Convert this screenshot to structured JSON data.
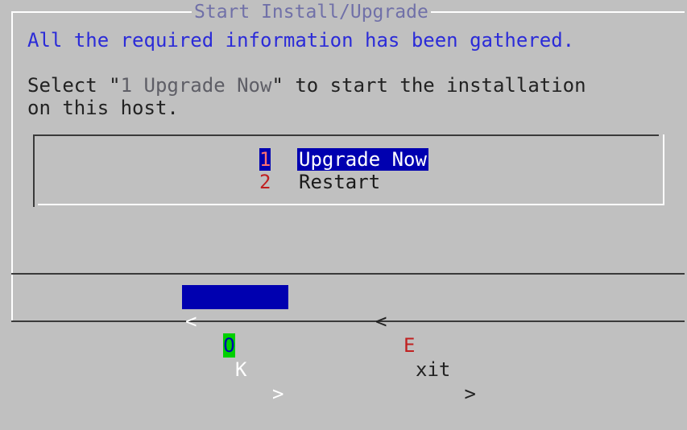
{
  "dialog": {
    "title": "Start Install/Upgrade",
    "line1": "All the required information has been gathered.",
    "line2_prefix": "Select \"",
    "line2_highlight": "1 Upgrade Now",
    "line2_suffix": "\" to start the installation",
    "line3": "on this host."
  },
  "menu": {
    "items": [
      {
        "tag": "1",
        "label": "Upgrade Now",
        "selected": true
      },
      {
        "tag": "2",
        "label": "Restart",
        "selected": false
      }
    ]
  },
  "buttons": {
    "ok": {
      "left": "<",
      "pre": " ",
      "hotkey": "O",
      "rest": "K",
      "right": ">"
    },
    "exit": {
      "left": "<",
      "pre": " ",
      "hotkey": "E",
      "rest": "xit",
      "right": " >"
    }
  }
}
